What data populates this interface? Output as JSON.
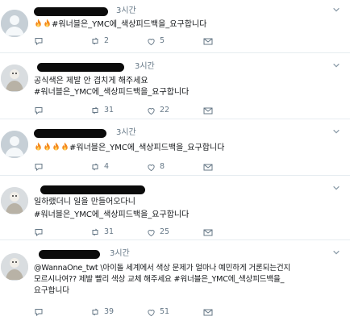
{
  "tweets": [
    {
      "name": "",
      "time": "3시간",
      "lines": [
        "🔥🔥#워너블은_YMC에_색상피드백을_요구합니다"
      ],
      "fire_count": 2,
      "text_after_fire": "#워너블은_YMC에_색상피드백을_요구합니다",
      "retweets": "2",
      "likes": "5",
      "avatar": "default-avatar"
    },
    {
      "name": "",
      "time": "3시간",
      "lines": [
        "공식색은 제발 안 겹치게 해주세요",
        "#워너블은_YMC에_색상피드백을_요구합니다"
      ],
      "retweets": "31",
      "likes": "22",
      "avatar": "photo-avatar"
    },
    {
      "name": "",
      "time": "3시간",
      "fire_count": 4,
      "text_after_fire": "#워너블은_YMC에_색상피드백을_요구합니다",
      "retweets": "4",
      "likes": "8",
      "avatar": "default-avatar"
    },
    {
      "name": "",
      "time": "",
      "lines": [
        "일하랬더니 일을 만들어오다니",
        "#워너블은_YMC에_색상피드백을_요구합니다"
      ],
      "retweets": "31",
      "likes": "25",
      "avatar": "photo-avatar"
    },
    {
      "name": "",
      "time": "3시간",
      "lines": [
        "@WannaOne_twt \\아이돌 세계에서 색상 문제가 얼마나 예민하게 거론되는건지",
        "모르시나여?? 제발 빨리 색상 교체 해주세요 #워너블은_YMC에_색상피드백을_",
        "요구합니다"
      ],
      "retweets": "39",
      "likes": "51",
      "avatar": "photo-avatar"
    }
  ],
  "icons": {
    "reply": "reply-icon",
    "retweet": "retweet-icon",
    "like": "heart-icon",
    "dm": "mail-icon",
    "more": "chevron-down-icon",
    "fire": "fire-icon"
  },
  "colors": {
    "text": "#14171a",
    "muted": "#657786",
    "divider": "#e6ecf0",
    "fire": "#f58a1f"
  }
}
